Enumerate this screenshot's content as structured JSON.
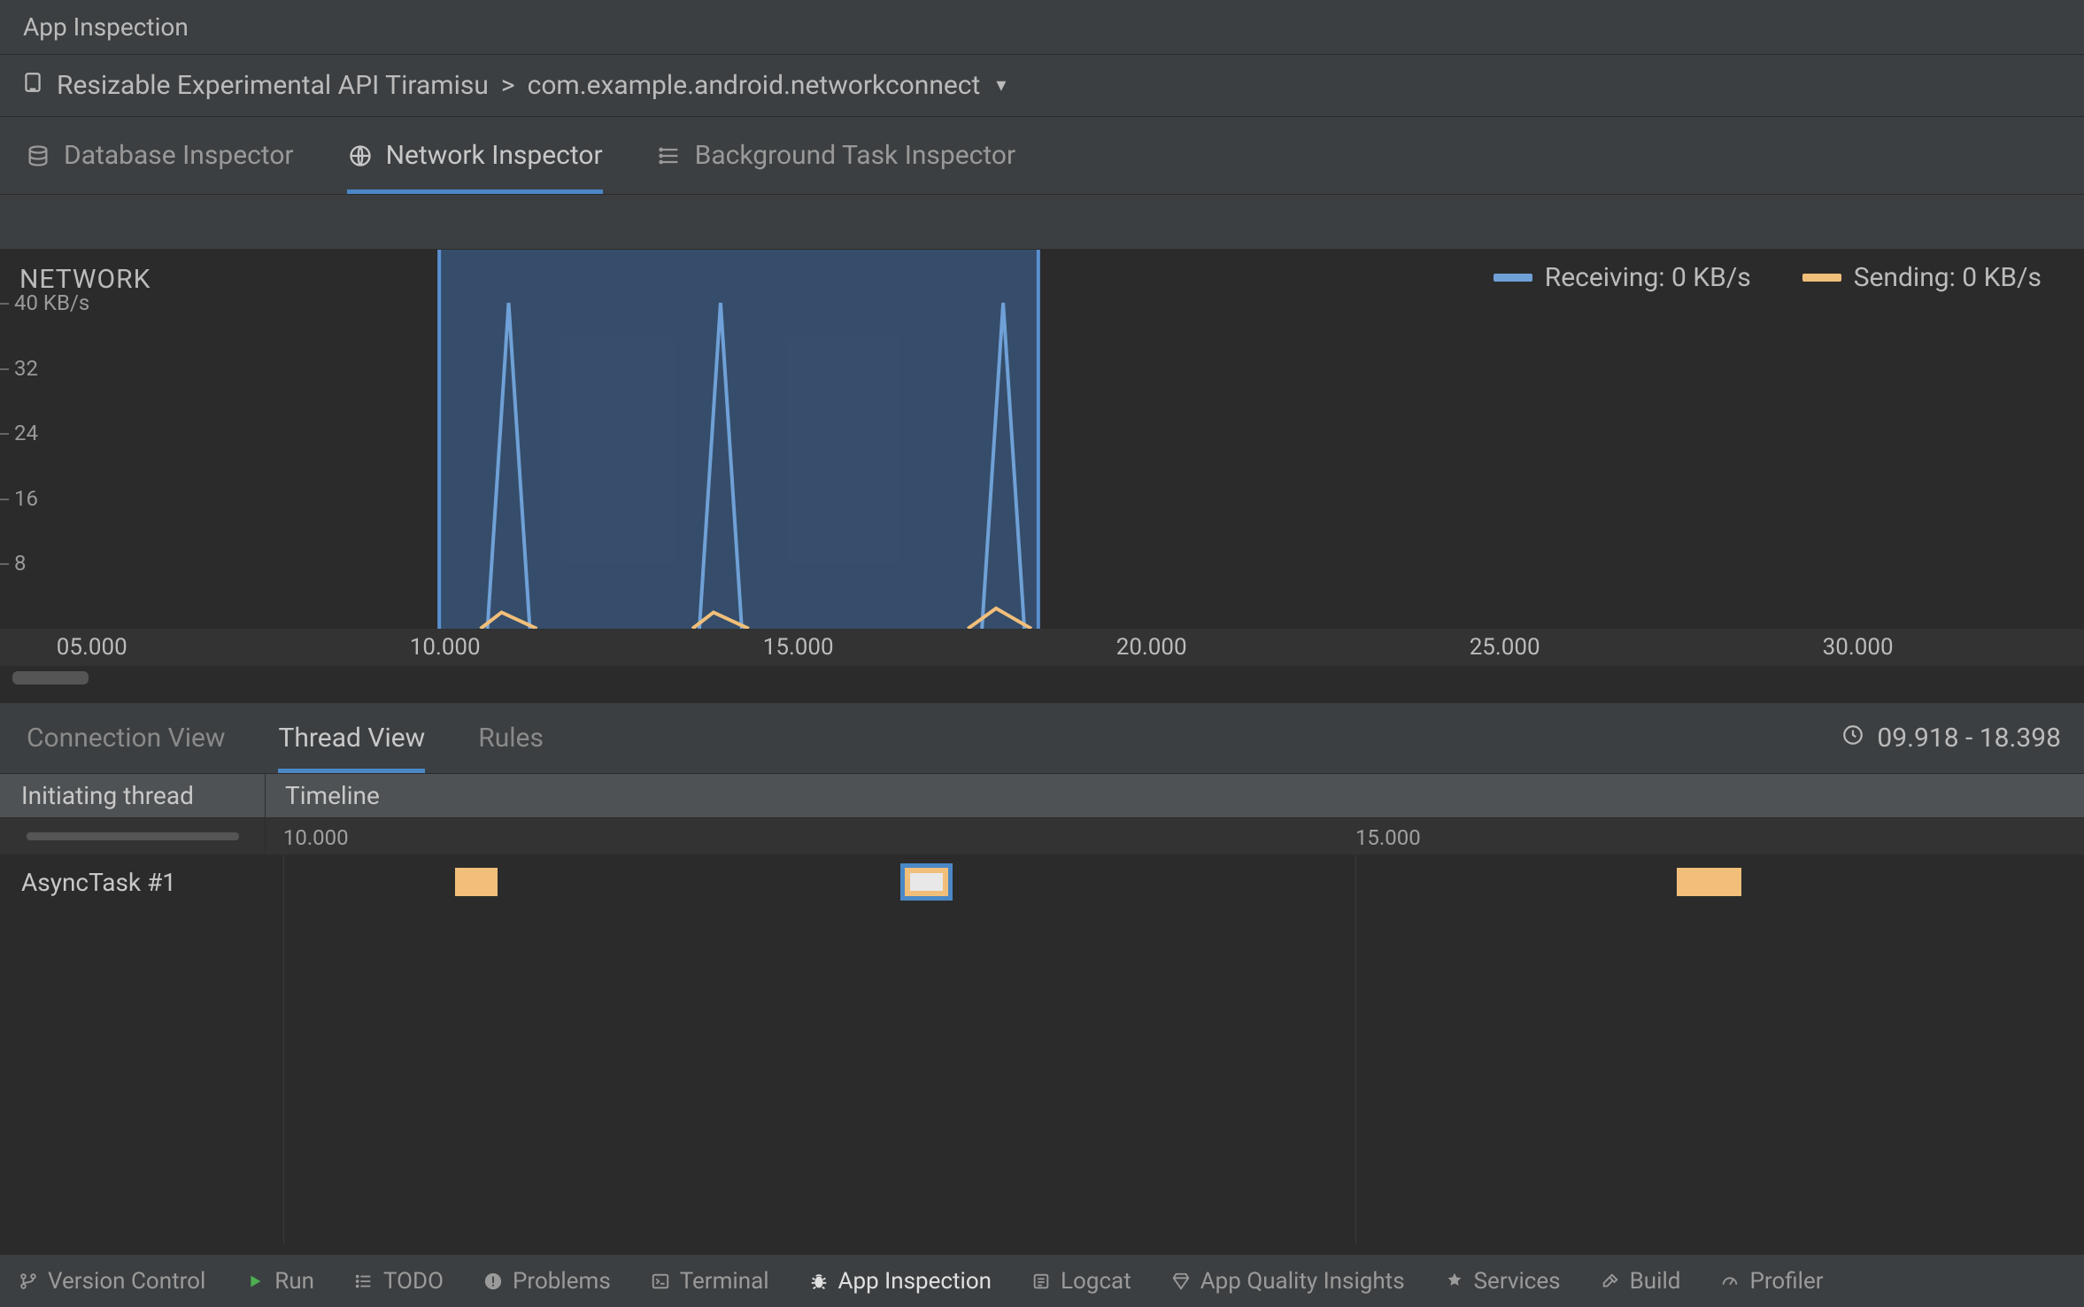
{
  "title": "App Inspection",
  "target": {
    "device": "Resizable Experimental API Tiramisu",
    "sep": ">",
    "process": "com.example.android.networkconnect"
  },
  "inspector_tabs": [
    {
      "label": "Database Inspector",
      "active": false
    },
    {
      "label": "Network Inspector",
      "active": true
    },
    {
      "label": "Background Task Inspector",
      "active": false
    }
  ],
  "legend": {
    "receiving_label": "Receiving: 0 KB/s",
    "sending_label": "Sending: 0 KB/s"
  },
  "chart_title": "NETWORK",
  "chart_data": {
    "type": "line",
    "x_unit": "seconds",
    "xlim_visible": [
      3.7,
      33.2
    ],
    "x_ticks": [
      "05.000",
      "10.000",
      "15.000",
      "20.000",
      "25.000",
      "30.000"
    ],
    "y_unit": "KB/s",
    "ylim": [
      0,
      40
    ],
    "y_ticks": [
      8,
      16,
      24,
      32,
      40
    ],
    "y_tick_labels": [
      "8",
      "16",
      "24",
      "32",
      "40 KB/s"
    ],
    "selection": {
      "start": 9.918,
      "end": 18.398
    },
    "series": [
      {
        "name": "Receiving",
        "color": "#6fa0d7",
        "values": [
          {
            "x": 10.6,
            "y": 0
          },
          {
            "x": 10.9,
            "y": 40
          },
          {
            "x": 11.2,
            "y": 0
          },
          {
            "x": 13.6,
            "y": 0
          },
          {
            "x": 13.9,
            "y": 40
          },
          {
            "x": 14.2,
            "y": 0
          },
          {
            "x": 17.6,
            "y": 0
          },
          {
            "x": 17.9,
            "y": 40
          },
          {
            "x": 18.2,
            "y": 0
          }
        ]
      },
      {
        "name": "Sending",
        "color": "#f1bf7a",
        "values": [
          {
            "x": 10.5,
            "y": 0
          },
          {
            "x": 10.8,
            "y": 2
          },
          {
            "x": 11.3,
            "y": 0
          },
          {
            "x": 13.5,
            "y": 0
          },
          {
            "x": 13.8,
            "y": 2
          },
          {
            "x": 14.3,
            "y": 0
          },
          {
            "x": 17.4,
            "y": 0
          },
          {
            "x": 17.8,
            "y": 2.5
          },
          {
            "x": 18.3,
            "y": 0
          }
        ]
      }
    ]
  },
  "view_tabs": [
    {
      "label": "Connection View",
      "active": false
    },
    {
      "label": "Thread View",
      "active": true
    },
    {
      "label": "Rules",
      "active": false
    }
  ],
  "time_range_label": "09.918 - 18.398",
  "thread_table": {
    "col_thread": "Initiating thread",
    "col_timeline": "Timeline",
    "ticks": [
      "10.000",
      "15.000"
    ],
    "rows": [
      {
        "thread": "AsyncTask #1",
        "events": [
          {
            "start": 10.8,
            "end": 11.0,
            "selected": false
          },
          {
            "start": 12.9,
            "end": 13.1,
            "selected": true
          },
          {
            "start": 16.5,
            "end": 16.8,
            "selected": false
          }
        ]
      }
    ]
  },
  "bottom_buttons": [
    {
      "label": "Version Control",
      "icon": "branch"
    },
    {
      "label": "Run",
      "icon": "play"
    },
    {
      "label": "TODO",
      "icon": "list"
    },
    {
      "label": "Problems",
      "icon": "warn"
    },
    {
      "label": "Terminal",
      "icon": "terminal"
    },
    {
      "label": "App Inspection",
      "icon": "bug",
      "active": true
    },
    {
      "label": "Logcat",
      "icon": "log"
    },
    {
      "label": "App Quality Insights",
      "icon": "diamond"
    },
    {
      "label": "Services",
      "icon": "services"
    },
    {
      "label": "Build",
      "icon": "hammer"
    },
    {
      "label": "Profiler",
      "icon": "gauge"
    }
  ]
}
